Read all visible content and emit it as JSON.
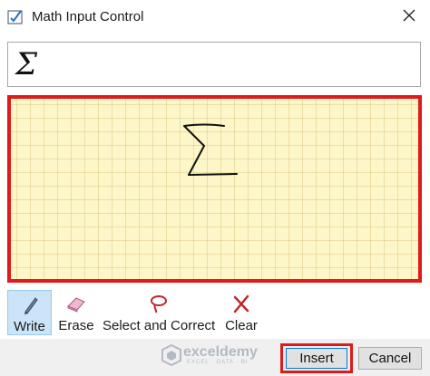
{
  "window": {
    "title": "Math Input Control",
    "app_icon": "math-input-icon",
    "close_icon": "close-icon"
  },
  "preview": {
    "expression": "Σ"
  },
  "write_area": {
    "handwriting": "Σ",
    "border_color": "#e01a1a",
    "background_color": "#fdf6c8"
  },
  "toolbar": {
    "tools": [
      {
        "label": "Write",
        "icon": "pen-icon",
        "selected": true
      },
      {
        "label": "Erase",
        "icon": "eraser-icon",
        "selected": false
      },
      {
        "label": "Select and Correct",
        "icon": "lasso-icon",
        "selected": false
      },
      {
        "label": "Clear",
        "icon": "clear-x-icon",
        "selected": false
      }
    ]
  },
  "footer": {
    "watermark_name": "exceldemy",
    "watermark_tag": "EXCEL · DATA · BI",
    "insert_label": "Insert",
    "cancel_label": "Cancel"
  },
  "colors": {
    "highlight_red": "#e01a1a",
    "selected_tool_bg": "#cce4f7"
  }
}
